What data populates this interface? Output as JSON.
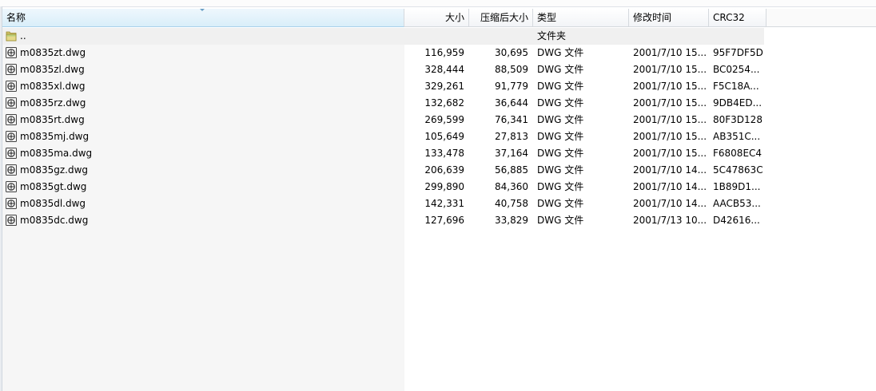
{
  "columns": {
    "name": "名称",
    "size": "大小",
    "compressed": "压缩后大小",
    "type": "类型",
    "modified": "修改时间",
    "crc": "CRC32"
  },
  "parent": {
    "name": "..",
    "type": "文件夹"
  },
  "files": [
    {
      "name": "m0835zt.dwg",
      "size": "116,959",
      "compressed": "30,695",
      "type": "DWG 文件",
      "modified": "2001/7/10 15...",
      "crc": "95F7DF5D"
    },
    {
      "name": "m0835zl.dwg",
      "size": "328,444",
      "compressed": "88,509",
      "type": "DWG 文件",
      "modified": "2001/7/10 15...",
      "crc": "BC0254..."
    },
    {
      "name": "m0835xl.dwg",
      "size": "329,261",
      "compressed": "91,779",
      "type": "DWG 文件",
      "modified": "2001/7/10 15...",
      "crc": "F5C18A..."
    },
    {
      "name": "m0835rz.dwg",
      "size": "132,682",
      "compressed": "36,644",
      "type": "DWG 文件",
      "modified": "2001/7/10 15...",
      "crc": "9DB4ED..."
    },
    {
      "name": "m0835rt.dwg",
      "size": "269,599",
      "compressed": "76,341",
      "type": "DWG 文件",
      "modified": "2001/7/10 15...",
      "crc": "80F3D128"
    },
    {
      "name": "m0835mj.dwg",
      "size": "105,649",
      "compressed": "27,813",
      "type": "DWG 文件",
      "modified": "2001/7/10 15...",
      "crc": "AB351C..."
    },
    {
      "name": "m0835ma.dwg",
      "size": "133,478",
      "compressed": "37,164",
      "type": "DWG 文件",
      "modified": "2001/7/10 15...",
      "crc": "F6808EC4"
    },
    {
      "name": "m0835gz.dwg",
      "size": "206,639",
      "compressed": "56,885",
      "type": "DWG 文件",
      "modified": "2001/7/10 14...",
      "crc": "5C47863C"
    },
    {
      "name": "m0835gt.dwg",
      "size": "299,890",
      "compressed": "84,360",
      "type": "DWG 文件",
      "modified": "2001/7/10 14...",
      "crc": "1B89D1..."
    },
    {
      "name": "m0835dl.dwg",
      "size": "142,331",
      "compressed": "40,758",
      "type": "DWG 文件",
      "modified": "2001/7/10 14...",
      "crc": "AACB53..."
    },
    {
      "name": "m0835dc.dwg",
      "size": "127,696",
      "compressed": "33,829",
      "type": "DWG 文件",
      "modified": "2001/7/13 10...",
      "crc": "D42616..."
    }
  ]
}
